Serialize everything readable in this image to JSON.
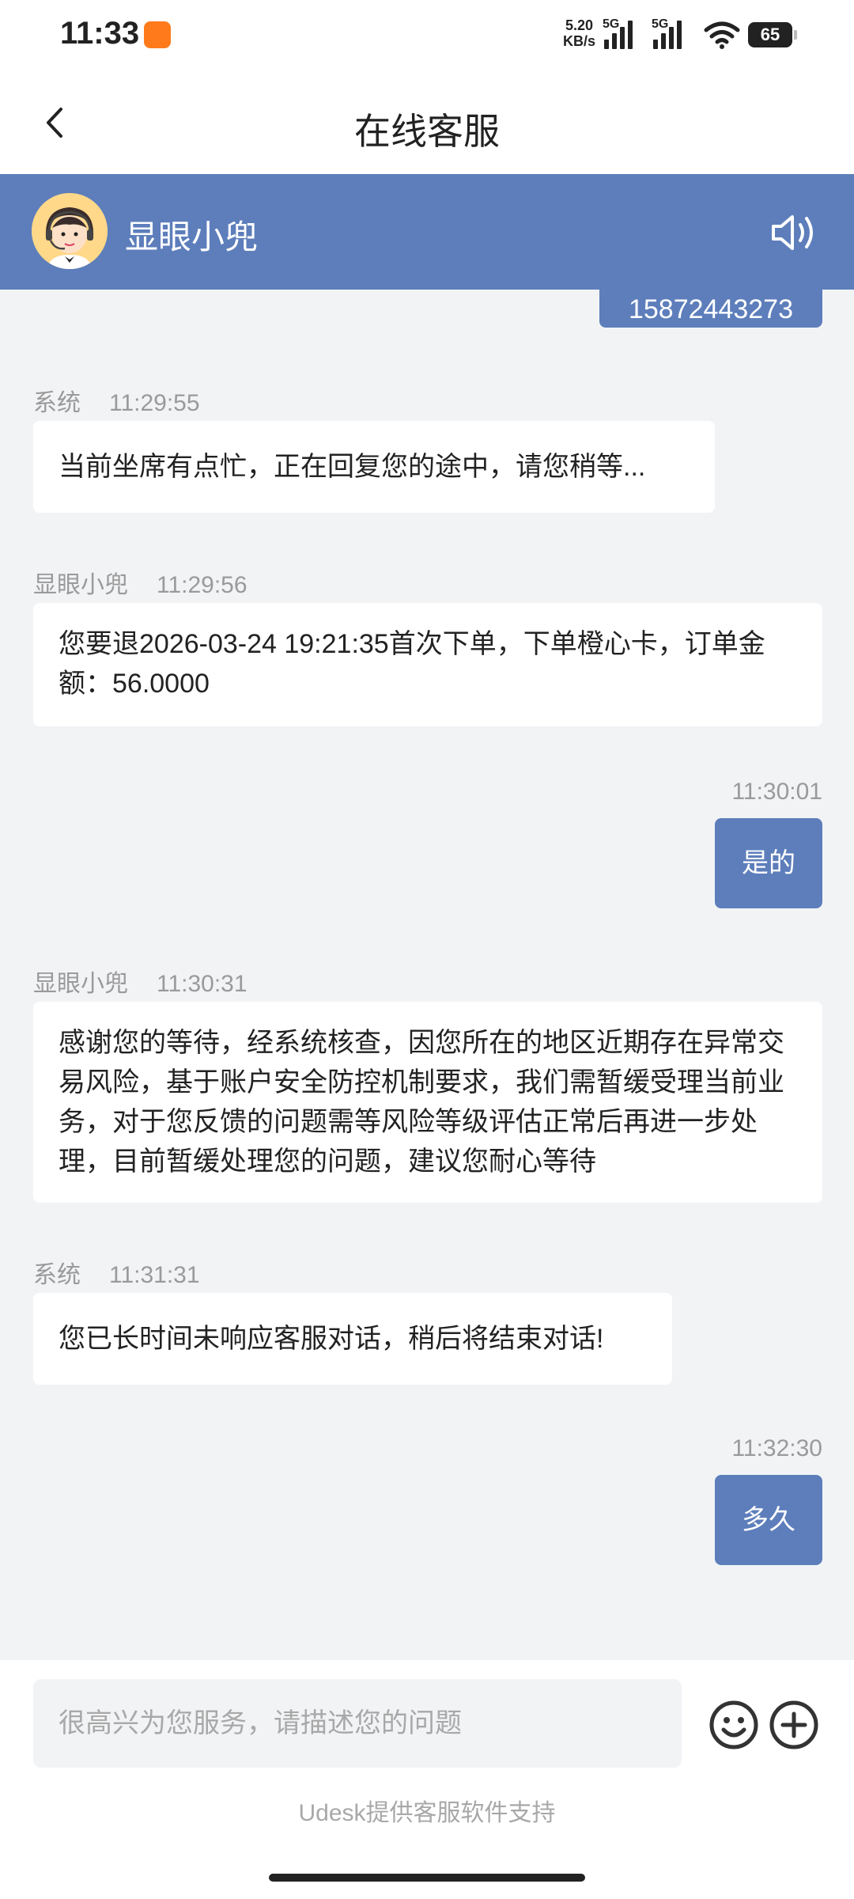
{
  "status_bar": {
    "time": "11:33",
    "net_speed": "5.20",
    "net_speed_unit": "KB/s",
    "sim1_tag": "5G",
    "sim2_tag": "5G",
    "battery": "65",
    "app_icon": "orange-app-notification-icon"
  },
  "header": {
    "title": "在线客服",
    "back_icon": "chevron-left-icon"
  },
  "agent_bar": {
    "name": "显眼小兜",
    "avatar_icon": "agent-headset-avatar",
    "speaker_icon": "speaker-icon"
  },
  "messages": [
    {
      "side": "me",
      "text": "15872443273"
    },
    {
      "side": "agent",
      "sender": "系统",
      "time": "11:29:55",
      "text": "当前坐席有点忙，正在回复您的途中，请您稍等..."
    },
    {
      "side": "agent",
      "sender": "显眼小兜",
      "time": "11:29:56",
      "text": "您要退2026-03-24 19:21:35首次下单，下单橙心卡，订单金额：56.0000"
    },
    {
      "side": "me",
      "time": "11:30:01",
      "text": "是的"
    },
    {
      "side": "agent",
      "sender": "显眼小兜",
      "time": "11:30:31",
      "text": "感谢您的等待，经系统核查，因您所在的地区近期存在异常交易风险，基于账户安全防控机制要求，我们需暂缓受理当前业务，对于您反馈的问题需等风险等级评估正常后再进一步处理，目前暂缓处理您的问题，建议您耐心等待"
    },
    {
      "side": "agent",
      "sender": "系统",
      "time": "11:31:31",
      "text": "您已长时间未响应客服对话，稍后将结束对话!"
    },
    {
      "side": "me",
      "time": "11:32:30",
      "text": "多久"
    }
  ],
  "input": {
    "placeholder": "很高兴为您服务，请描述您的问题",
    "emoji_icon": "emoji-icon",
    "plus_icon": "plus-icon"
  },
  "footer": {
    "powered_by": "Udesk提供客服软件支持"
  },
  "colors": {
    "accent": "#5d7ebb",
    "chat_bg": "#f2f3f5"
  }
}
